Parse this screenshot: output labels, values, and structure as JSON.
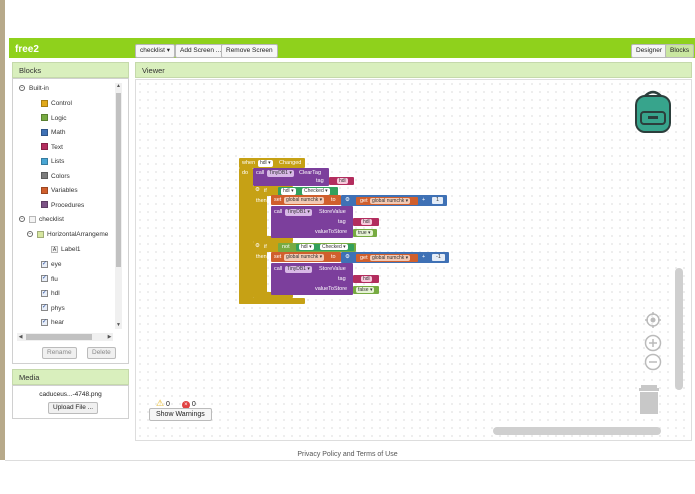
{
  "project_name": "free2",
  "toolbar": {
    "screen_selector": "checklist ▾",
    "add_screen": "Add Screen ...",
    "remove_screen": "Remove Screen",
    "designer": "Designer",
    "blocks": "Blocks"
  },
  "blocks_panel": {
    "title": "Blocks",
    "builtin_label": "Built-in",
    "builtin_items": [
      {
        "label": "Control",
        "color": "#e1a91a"
      },
      {
        "label": "Logic",
        "color": "#77ab41"
      },
      {
        "label": "Math",
        "color": "#3f71b5"
      },
      {
        "label": "Text",
        "color": "#b32d5e"
      },
      {
        "label": "Lists",
        "color": "#49a6d4"
      },
      {
        "label": "Colors",
        "color": "#7d7d7d"
      },
      {
        "label": "Variables",
        "color": "#d05f2d"
      },
      {
        "label": "Procedures",
        "color": "#7c5385"
      }
    ],
    "screen_label": "checklist",
    "arrangement_label": "HorizontalArrangeme",
    "label1": "Label1",
    "checkboxes": [
      "eye",
      "flu",
      "hdl",
      "phys",
      "hear"
    ],
    "rename": "Rename",
    "delete": "Delete"
  },
  "media_panel": {
    "title": "Media",
    "file": "caduceus...-4748.png",
    "upload": "Upload File ..."
  },
  "viewer": {
    "title": "Viewer",
    "warnings_count": "0",
    "errors_count": "0",
    "show_warnings": "Show Warnings"
  },
  "code_blocks": {
    "when": "when",
    "hdl": "hdl",
    "changed": "Changed",
    "do": "do",
    "call": "call",
    "tinydb": "TinyDB1",
    "cleartag": "ClearTag",
    "tag": "tag",
    "hdl_str": "hdl",
    "if": "if",
    "then": "then",
    "checked": "Checked",
    "not": "not",
    "set": "set",
    "global_numchk": "global numchk",
    "to": "to",
    "get": "get",
    "plus": "+",
    "one": "1",
    "minus_one": "-1",
    "storevalue": "StoreValue",
    "valuetostore": "valueToStore",
    "true": "true",
    "false": "false"
  },
  "footer": {
    "text": "Privacy Policy and Terms of Use"
  },
  "colors": {
    "green_bar": "#8fd11c",
    "panel_head": "#d9efbd",
    "event_block": "#c6a115",
    "component_block": "#7c3f9c",
    "variable_block": "#d05f2d",
    "logic_block": "#77ab41",
    "text_block": "#b32d5e",
    "math_block": "#3f71b5",
    "control_block": "#c6a115"
  }
}
